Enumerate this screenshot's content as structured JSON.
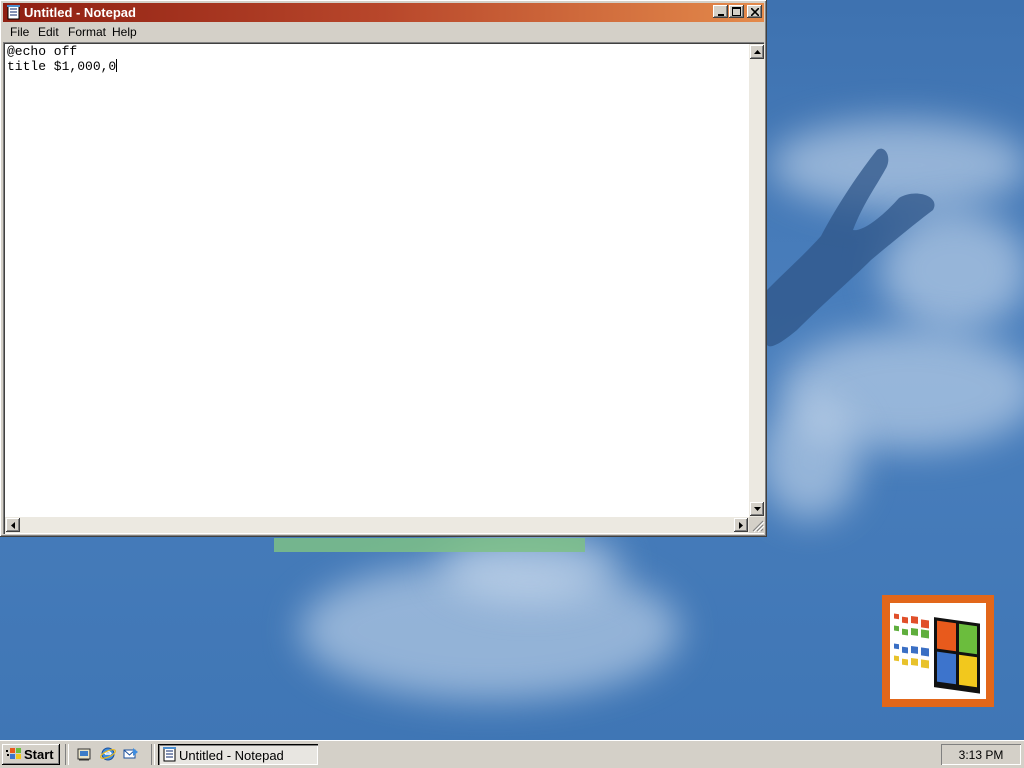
{
  "window": {
    "title": "Untitled - Notepad",
    "menu": [
      "File",
      "Edit",
      "Format",
      "Help"
    ]
  },
  "editor": {
    "lines": [
      "@echo off",
      "title $1,000,0"
    ]
  },
  "taskbar": {
    "start_label": "Start",
    "task_label": "Untitled - Notepad",
    "clock": "3:13 PM"
  },
  "colors": {
    "titlebar_start": "#8f1f12",
    "titlebar_end": "#e48a4b",
    "desktop": "#3f74b3",
    "logo_frame": "#e2671a"
  }
}
